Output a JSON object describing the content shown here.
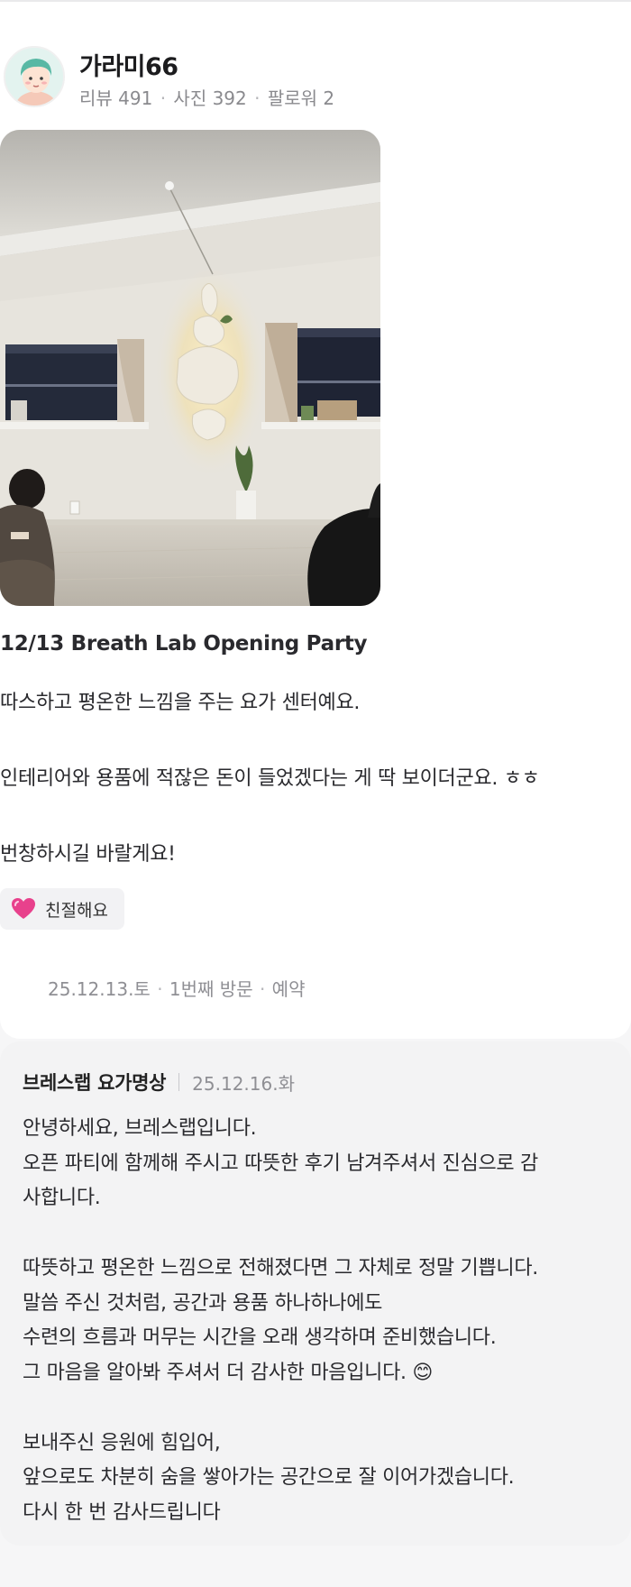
{
  "user": {
    "name": "가라미66",
    "reviews_label": "리뷰 491",
    "photos_label": "사진 392",
    "followers_label": "팔로워 2",
    "separator": "·"
  },
  "review": {
    "title": "12/13 Breath Lab Opening Party",
    "lines": [
      "따스하고 평온한 느낌을 주는 요가 센터예요.",
      "인테리어와 용품에 적잖은 돈이 들었겠다는 게 딱 보이더군요. ㅎㅎ",
      "번창하시길 바랄게요!"
    ],
    "tag_label": "친절해요",
    "visit_date": "25.12.13.토",
    "visit_count": "1번째 방문",
    "visit_type": "예약"
  },
  "reply": {
    "name": "브레스랩 요가명상",
    "date": "25.12.16.화",
    "lines": [
      "안녕하세요, 브레스랩입니다.",
      "오픈 파티에 함께해 주시고 따뜻한 후기 남겨주셔서 진심으로 감",
      "사합니다.",
      "따뜻하고 평온한 느낌으로 전해졌다면 그 자체로 정말 기쁩니다.",
      "말씀 주신 것처럼, 공간과 용품 하나하나에도",
      "수련의 흐름과 머무는 시간을 오래 생각하며 준비했습니다.",
      "그 마음을 알아봐 주셔서 더 감사한 마음입니다. 😊",
      "보내주신 응원에 힘입어,",
      "앞으로도 차분히 숨을 쌓아가는 공간으로 잘 이어가겠습니다.",
      "다시 한 번 감사드립니다"
    ]
  },
  "icons": {
    "avatar": "user-avatar",
    "tag": "heart-icon",
    "photo": "review-photo"
  },
  "colors": {
    "background": "#f6f6f7",
    "card": "#ffffff",
    "reply_bg": "#f3f3f4",
    "muted_text": "#8f8f94",
    "heart": "#e8418c"
  }
}
